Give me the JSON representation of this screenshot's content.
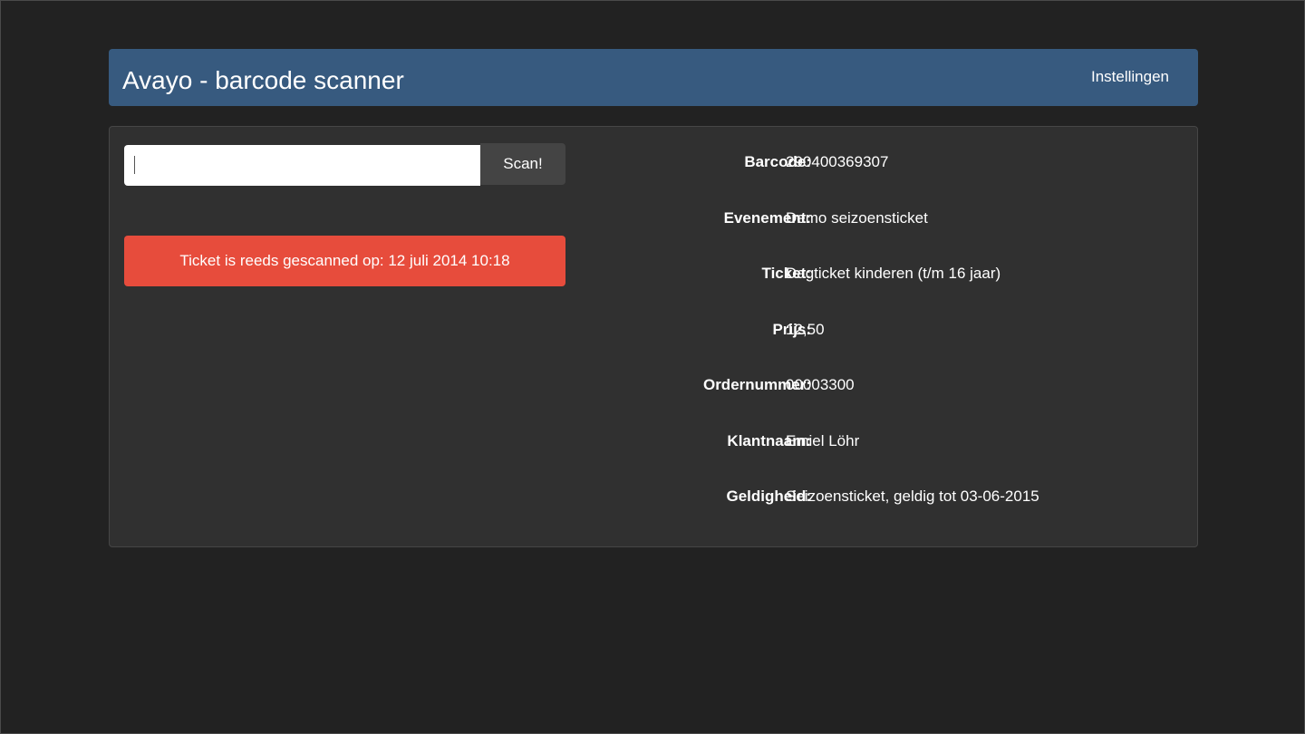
{
  "navbar": {
    "brand": "Avayo - barcode scanner",
    "settings_label": "Instellingen"
  },
  "scanner": {
    "input_value": "",
    "button_label": "Scan!"
  },
  "alert": {
    "message": "Ticket is reeds gescanned op: 12 juli 2014 10:18",
    "color": "#e74c3c"
  },
  "details": [
    {
      "label": "Barcode:",
      "value": "290400369307"
    },
    {
      "label": "Evenement:",
      "value": "Demo seizoensticket"
    },
    {
      "label": "Ticket:",
      "value": "Dagticket kinderen (t/m 16 jaar)"
    },
    {
      "label": "Prijs:",
      "value": "12,50"
    },
    {
      "label": "Ordernummer:",
      "value": "00003300"
    },
    {
      "label": "Klantnaam:",
      "value": "Emiel Löhr"
    },
    {
      "label": "Geldigheid:",
      "value": "Seizoensticket, geldig tot 03-06-2015"
    }
  ],
  "colors": {
    "background": "#222222",
    "navbar": "#375a7f",
    "panel": "#303030",
    "button": "#444444"
  }
}
